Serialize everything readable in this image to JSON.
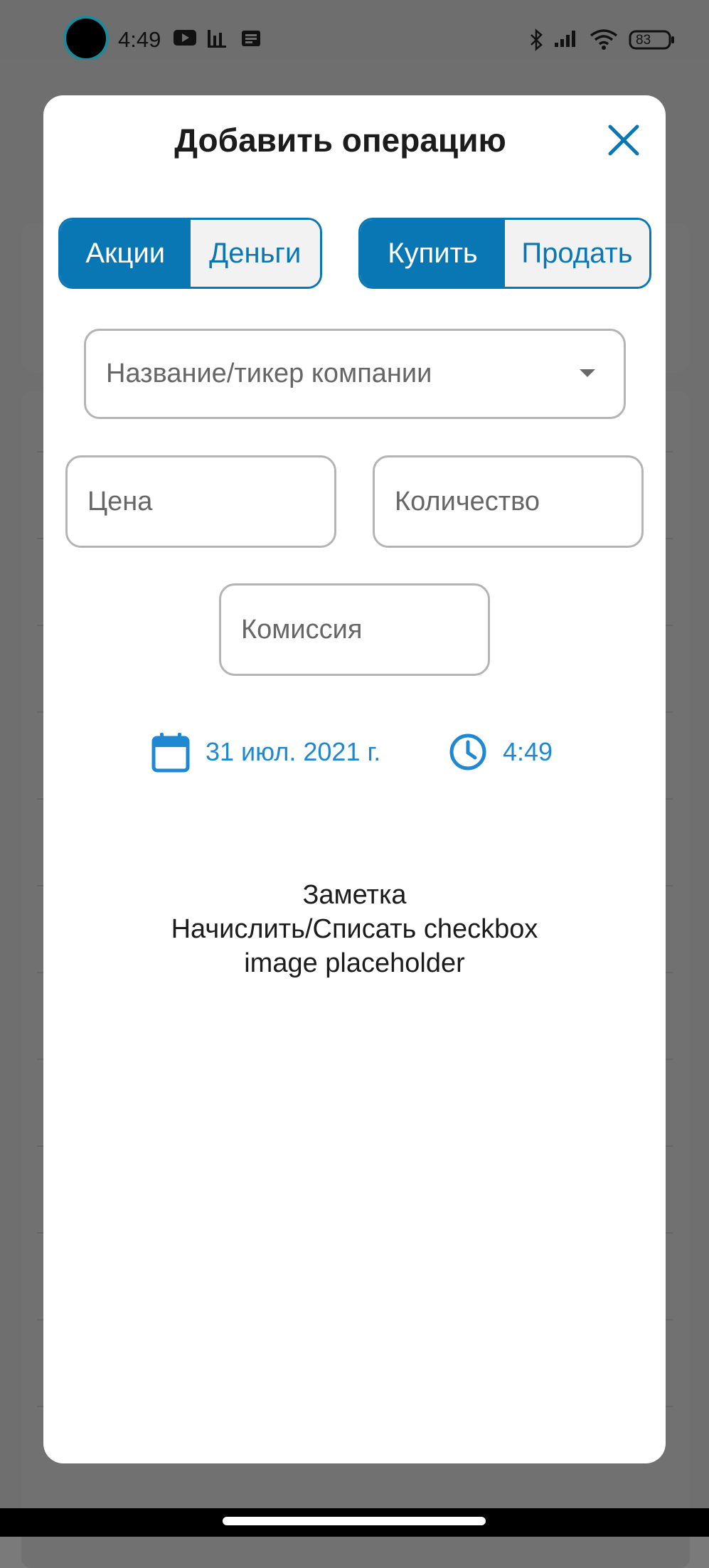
{
  "status_bar": {
    "time": "4:49",
    "battery": "83",
    "icons": [
      "youtube-icon",
      "chart-icon",
      "news-icon",
      "bluetooth-icon",
      "signal-icon",
      "wifi-icon",
      "battery-icon"
    ]
  },
  "dialog": {
    "title": "Добавить операцию",
    "close_icon": "close-icon",
    "asset_toggle": {
      "options": [
        "Акции",
        "Деньги"
      ],
      "selected": "Акции"
    },
    "action_toggle": {
      "options": [
        "Купить",
        "Продать"
      ],
      "selected": "Купить"
    },
    "company": {
      "placeholder": "Название/тикер компании",
      "value": ""
    },
    "price": {
      "placeholder": "Цена",
      "value": ""
    },
    "quantity": {
      "placeholder": "Количество",
      "value": ""
    },
    "commission": {
      "placeholder": "Комиссия",
      "value": ""
    },
    "date": {
      "icon": "calendar-icon",
      "value": "31 июл. 2021 г."
    },
    "time": {
      "icon": "clock-icon",
      "value": "4:49"
    },
    "placeholder_lines": [
      "Заметка",
      "Начислить/Списать checkbox",
      "image placeholder"
    ]
  },
  "colors": {
    "accent": "#0a77b5",
    "date_time": "#1e88d3",
    "scrim": "#6f6f6f"
  }
}
